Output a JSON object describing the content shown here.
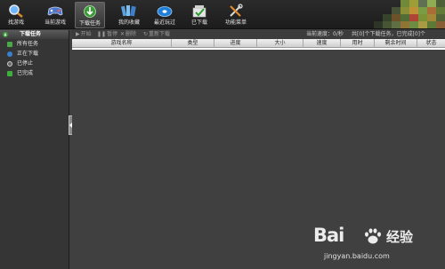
{
  "toolbar": {
    "items": [
      {
        "label": "找游戏",
        "icon": "magnifier-icon"
      },
      {
        "label": "当前游戏",
        "icon": "gamepad-icon"
      },
      {
        "label": "下载任务",
        "icon": "download-globe-icon"
      },
      {
        "label": "我的收藏",
        "icon": "bookshelf-icon"
      },
      {
        "label": "最近玩过",
        "icon": "recent-disc-icon"
      },
      {
        "label": "已下载",
        "icon": "folder-check-icon"
      },
      {
        "label": "功能菜单",
        "icon": "tools-icon"
      }
    ]
  },
  "sidebar": {
    "header": "下载任务",
    "items": [
      {
        "label": "所有任务",
        "icon": "all-tasks-icon",
        "color": "#4aa84a"
      },
      {
        "label": "正在下载",
        "icon": "downloading-icon",
        "color": "#3a7fd0"
      },
      {
        "label": "已停止",
        "icon": "stopped-icon",
        "color": "#6a6a6a"
      },
      {
        "label": "已完成",
        "icon": "completed-icon",
        "color": "#3fae3f"
      }
    ]
  },
  "actions": {
    "start": "开始",
    "pause": "暂停",
    "delete": "删除",
    "redownload": "重新下载",
    "speed": "当前速度：0/秒",
    "summary": "共[0]个下载任务，已完成[0]个"
  },
  "table": {
    "columns": [
      "游戏名称",
      "类型",
      "进度",
      "大小",
      "速度",
      "用时",
      "剩余时间",
      "状态"
    ]
  },
  "watermark": {
    "logo_left": "Bai",
    "logo_right": "经验",
    "url": "jingyan.baidu.com"
  },
  "colors": {
    "accent": "#4aa84a",
    "background": "#3f3f3f"
  }
}
